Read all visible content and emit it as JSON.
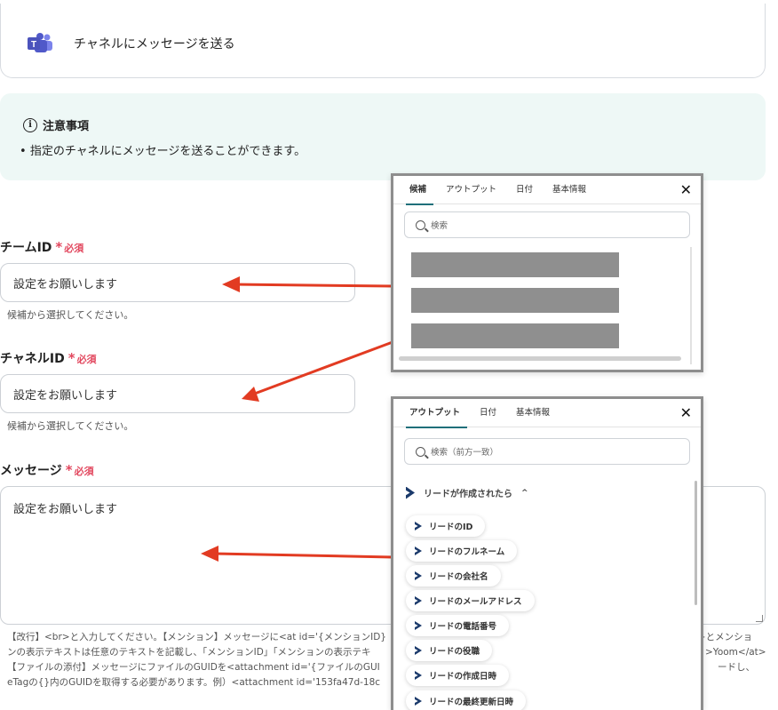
{
  "card": {
    "title": "チャネルにメッセージを送る",
    "logo": "teams-logo"
  },
  "notice": {
    "title": "注意事項",
    "bullet": "指定のチャネルにメッセージを送ることができます。"
  },
  "fields": {
    "team": {
      "label": "チームID",
      "required_star": "*",
      "required_text": "必須",
      "placeholder": "設定をお願いします",
      "help": "候補から選択してください。"
    },
    "channel": {
      "label": "チャネルID",
      "required_star": "*",
      "required_text": "必須",
      "placeholder": "設定をお願いします",
      "help": "候補から選択してください。"
    },
    "message": {
      "label": "メッセージ",
      "required_star": "*",
      "required_text": "必須",
      "placeholder": "設定をお願いします"
    }
  },
  "message_help": {
    "line1": "【改行】<br>と入力してください。【メンション】メッセージに<at id='{メンションID}",
    "line1_tail": "}とメンショ",
    "line2": "ンの表示テキストは任意のテキストを記載し、「メンションID」「メンションの表示テキ",
    "line2_tail": ">Yoom</at>",
    "line3": "【ファイルの添付】メッセージにファイルのGUIDを<attachment id='{ファイルのGUI",
    "line3_tail": "ードし、",
    "line4": "eTagの{}内のGUIDを取得する必要があります。例）<attachment id='153fa47d-18c"
  },
  "panel1": {
    "tabs": [
      "候補",
      "アウトプット",
      "日付",
      "基本情報"
    ],
    "active_tab": "候補",
    "search_placeholder": "検索",
    "close_label": "✕"
  },
  "panel2": {
    "tabs": [
      "アウトプット",
      "日付",
      "基本情報"
    ],
    "active_tab": "アウトプット",
    "search_placeholder": "検索（前方一致）",
    "close_label": "✕",
    "section_title": "リードが作成されたら",
    "items": [
      "リードのID",
      "リードのフルネーム",
      "リードの会社名",
      "リードのメールアドレス",
      "リードの電話番号",
      "リードの役職",
      "リードの作成日時",
      "リードの最終更新日時"
    ]
  },
  "colors": {
    "required": "#e2475e",
    "arrow": "#e23b22",
    "notice_bg": "#eef8f6",
    "tab_underline": "#1f6f7a"
  }
}
